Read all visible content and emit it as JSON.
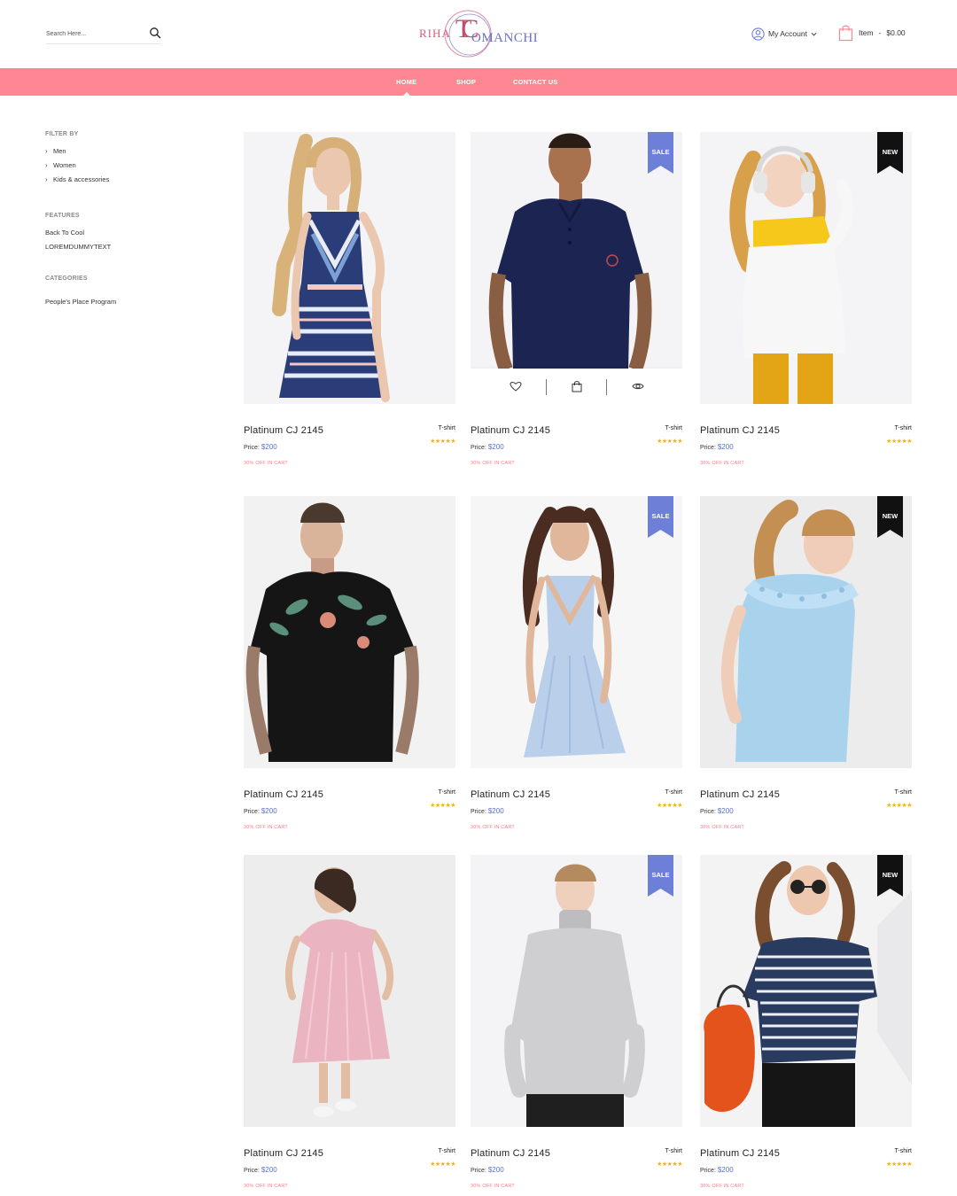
{
  "header": {
    "search_placeholder": "Search Here...",
    "logo_left": "RIHA",
    "logo_monogram": "TC",
    "logo_right": "OMANCHI",
    "account_label": "My Account",
    "cart_item_label": "Item",
    "cart_sep": "-",
    "cart_total": "$0.00"
  },
  "nav": {
    "items": [
      "HOME",
      "SHOP",
      "CONTACT US"
    ],
    "active": "HOME"
  },
  "sidebar": {
    "filter_heading": "FILTER BY",
    "filter_items": [
      "Men",
      "Women",
      "Kids & accessories"
    ],
    "features_heading": "FEATURES",
    "features_items": [
      "Back To Cool",
      "LOREMDUMMYTEXT"
    ],
    "categories_heading": "CATEGORIES",
    "categories_items": [
      "People's Place Program"
    ]
  },
  "products": [
    {
      "title": "Platinum CJ 2145",
      "type": "T-shirt",
      "price_label": "Price:",
      "price": "$200",
      "offer": "30% OFF IN CART",
      "badge": "",
      "stars": "★★★★★",
      "image": "woman-striped-dress"
    },
    {
      "title": "Platinum CJ 2145",
      "type": "T-shirt",
      "price_label": "Price:",
      "price": "$200",
      "offer": "30% OFF IN CART",
      "badge": "SALE",
      "stars": "★★★★★",
      "image": "man-navy-polo"
    },
    {
      "title": "Platinum CJ 2145",
      "type": "T-shirt",
      "price_label": "Price:",
      "price": "$200",
      "offer": "30% OFF IN CART",
      "badge": "NEW",
      "stars": "★★★★★",
      "image": "girl-headphones-sweater"
    },
    {
      "title": "Platinum CJ 2145",
      "type": "T-shirt",
      "price_label": "Price:",
      "price": "$200",
      "offer": "30% OFF IN CART",
      "badge": "",
      "stars": "★★★★★",
      "image": "man-floral-tshirt"
    },
    {
      "title": "Platinum CJ 2145",
      "type": "T-shirt",
      "price_label": "Price:",
      "price": "$200",
      "offer": "30% OFF IN CART",
      "badge": "SALE",
      "stars": "★★★★★",
      "image": "woman-blue-dress"
    },
    {
      "title": "Platinum CJ 2145",
      "type": "T-shirt",
      "price_label": "Price:",
      "price": "$200",
      "offer": "30% OFF IN CART",
      "badge": "NEW",
      "stars": "★★★★★",
      "image": "girl-blue-top"
    },
    {
      "title": "Platinum CJ 2145",
      "type": "T-shirt",
      "price_label": "Price:",
      "price": "$200",
      "offer": "30% OFF IN CART",
      "badge": "",
      "stars": "★★★★★",
      "image": "girl-pink-dress"
    },
    {
      "title": "Platinum CJ 2145",
      "type": "T-shirt",
      "price_label": "Price:",
      "price": "$200",
      "offer": "30% OFF IN CART",
      "badge": "SALE",
      "stars": "★★★★★",
      "image": "man-grey-sweater"
    },
    {
      "title": "Platinum CJ 2145",
      "type": "T-shirt",
      "price_label": "Price:",
      "price": "$200",
      "offer": "30% OFF IN CART",
      "badge": "NEW",
      "stars": "★★★★★",
      "image": "woman-striped-top-bag"
    }
  ],
  "quick_actions": [
    "wishlist-icon",
    "bag-icon",
    "eye-icon"
  ],
  "colors": {
    "accent": "#ff8793",
    "sale_badge": "#6e7fd8",
    "new_badge": "#111111",
    "price": "#5870d6",
    "stars": "#f4b400",
    "offer": "#ff7b86"
  }
}
